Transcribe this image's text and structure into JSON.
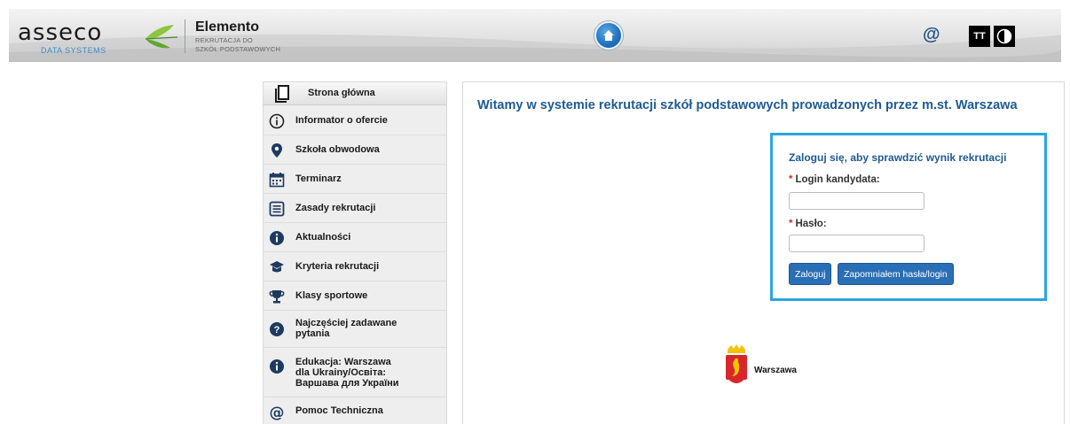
{
  "header": {
    "brand": "asseco",
    "brand_sub": "DATA SYSTEMS",
    "product_title": "Elemento",
    "product_sub_line1": "REKRUTACJA DO",
    "product_sub_line2": "SZKÓŁ PODSTAWOWYCH",
    "at_symbol": "@",
    "font_size_btn": "TT",
    "home_icon": "home-icon",
    "contrast_icon": "contrast-icon"
  },
  "sidebar": {
    "home": {
      "label": "Strona główna",
      "icon": "document-icon"
    },
    "items": [
      {
        "label": "Informator o ofercie",
        "icon": "info-circle-icon"
      },
      {
        "label": "Szkoła obwodowa",
        "icon": "location-pin-icon"
      },
      {
        "label": "Terminarz",
        "icon": "calendar-icon"
      },
      {
        "label": "Zasady rekrutacji",
        "icon": "rules-list-icon"
      },
      {
        "label": "Aktualności",
        "icon": "info-filled-icon"
      },
      {
        "label": "Kryteria rekrutacji",
        "icon": "graduation-cap-icon"
      },
      {
        "label": "Klasy sportowe",
        "icon": "trophy-icon"
      },
      {
        "label": "Najczęściej zadawane\npytania",
        "icon": "question-icon"
      },
      {
        "label": "Edukacja: Warszawa\ndla Ukrainy/Освіта:\nВаршава для України",
        "icon": "info-filled-icon"
      },
      {
        "label": "Pomoc Techniczna",
        "icon": "at-icon"
      }
    ]
  },
  "main": {
    "welcome": "Witamy w systemie rekrutacji szkół podstawowych prowadzonych przez m.st. Warszawa",
    "login": {
      "title": "Zaloguj się, aby sprawdzić wynik rekrutacji",
      "required_mark": "*",
      "login_label": "Login kandydata:",
      "login_value": "",
      "password_label": "Hasło:",
      "password_value": "",
      "submit_label": "Zaloguj",
      "forgot_label": "Zapomniałem hasła/login"
    },
    "city_logo_text": "Warszawa"
  },
  "colors": {
    "accent_blue": "#1f5a92",
    "button_blue": "#2a6fb5",
    "login_border": "#2aa5e0"
  }
}
